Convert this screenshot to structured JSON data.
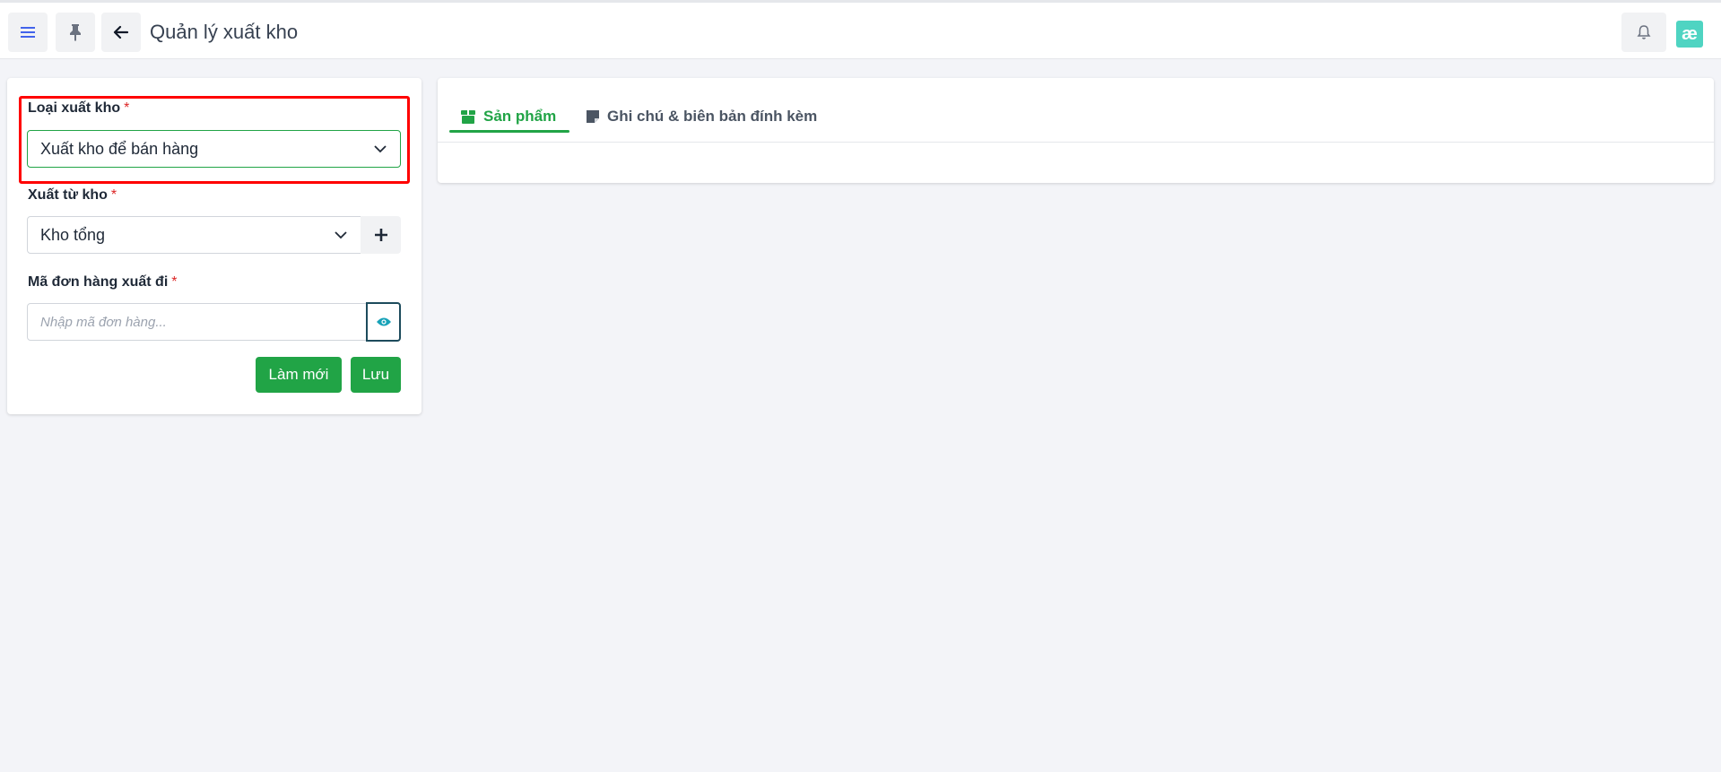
{
  "header": {
    "title": "Quản lý xuất kho",
    "logo_text": "æ",
    "icons": [
      "menu-icon",
      "pin-icon",
      "back-arrow-icon",
      "bell-icon"
    ],
    "accent_color": "#4263eb"
  },
  "form": {
    "export_type": {
      "label": "Loại xuất kho",
      "required_mark": "*",
      "value": "Xuất kho để bán hàng"
    },
    "from_warehouse": {
      "label": "Xuất từ kho",
      "required_mark": "*",
      "value": "Kho tổng"
    },
    "order_code": {
      "label": "Mã đơn hàng xuất đi",
      "required_mark": "*",
      "placeholder": "Nhập mã đơn hàng..."
    },
    "buttons": {
      "refresh": "Làm mới",
      "save": "Lưu"
    }
  },
  "tabs": [
    {
      "label": "Sản phẩm",
      "active": true,
      "icon": "box-icon"
    },
    {
      "label": "Ghi chú & biên bản đính kèm",
      "active": false,
      "icon": "note-icon"
    }
  ],
  "colors": {
    "primary_green": "#21a446",
    "highlight_red": "#ff0000",
    "required_red": "#dc2626"
  }
}
